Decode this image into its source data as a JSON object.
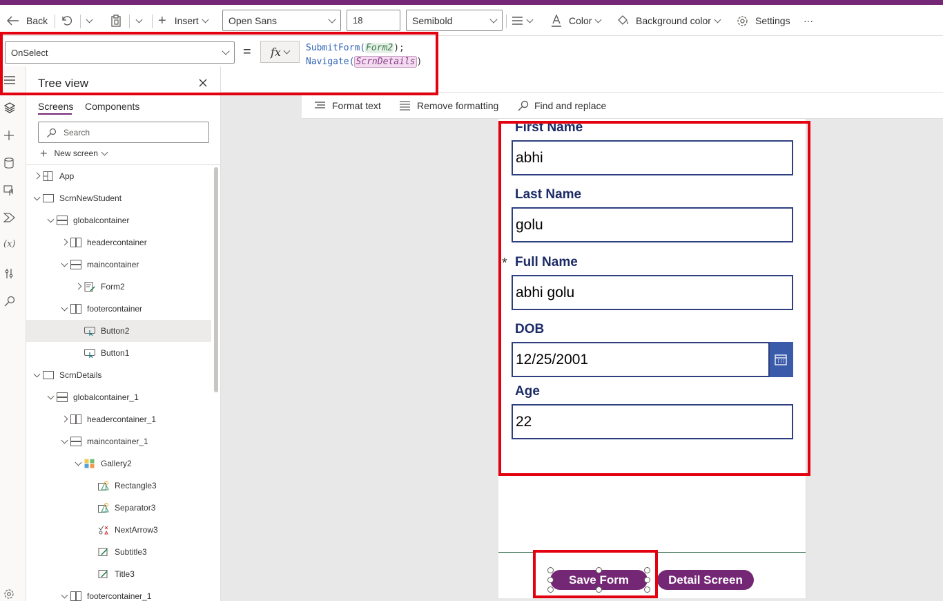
{
  "toolbar": {
    "back": "Back",
    "insert": "Insert",
    "font": "Open Sans",
    "font_size": "18",
    "font_weight": "Semibold",
    "color": "Color",
    "background_color": "Background color",
    "settings": "Settings",
    "more": "···"
  },
  "formula": {
    "property": "OnSelect",
    "equals": "=",
    "fx": "fx",
    "line1_fn": "SubmitForm(",
    "line1_arg": "Form2",
    "line1_end": ");",
    "line2_fn": "Navigate(",
    "line2_arg": "ScrnDetails",
    "line2_end": ")"
  },
  "format_bar": {
    "format_text": "Format text",
    "remove_formatting": "Remove formatting",
    "find_replace": "Find and replace"
  },
  "tree": {
    "title": "Tree view",
    "tabs": [
      "Screens",
      "Components"
    ],
    "search_placeholder": "Search",
    "new_screen": "New screen",
    "items": [
      {
        "label": "App",
        "icon": "app"
      },
      {
        "label": "ScrnNewStudent",
        "icon": "screen"
      },
      {
        "label": "globalcontainer",
        "icon": "vcontainer"
      },
      {
        "label": "headercontainer",
        "icon": "hcontainer"
      },
      {
        "label": "maincontainer",
        "icon": "vcontainer"
      },
      {
        "label": "Form2",
        "icon": "form"
      },
      {
        "label": "footercontainer",
        "icon": "hcontainer"
      },
      {
        "label": "Button2",
        "icon": "button"
      },
      {
        "label": "Button1",
        "icon": "button"
      },
      {
        "label": "ScrnDetails",
        "icon": "screen"
      },
      {
        "label": "globalcontainer_1",
        "icon": "vcontainer"
      },
      {
        "label": "headercontainer_1",
        "icon": "hcontainer"
      },
      {
        "label": "maincontainer_1",
        "icon": "vcontainer"
      },
      {
        "label": "Gallery2",
        "icon": "gallery"
      },
      {
        "label": "Rectangle3",
        "icon": "shape"
      },
      {
        "label": "Separator3",
        "icon": "shape"
      },
      {
        "label": "NextArrow3",
        "icon": "icon"
      },
      {
        "label": "Subtitle3",
        "icon": "label"
      },
      {
        "label": "Title3",
        "icon": "label"
      },
      {
        "label": "footercontainer_1",
        "icon": "hcontainer"
      }
    ]
  },
  "form": {
    "fields": [
      {
        "label": "First Name",
        "value": "abhi"
      },
      {
        "label": "Last Name",
        "value": "golu"
      },
      {
        "label": "Full Name",
        "value": "abhi golu",
        "required": "*"
      },
      {
        "label": "DOB",
        "value": "12/25/2001"
      },
      {
        "label": "Age",
        "value": "22"
      }
    ]
  },
  "buttons": {
    "save": "Save Form",
    "detail": "Detail Screen"
  },
  "colors": {
    "accent": "#742774",
    "highlight": "#e3000f",
    "field_label": "#1b2b66",
    "calendar": "#3a5ba9"
  }
}
